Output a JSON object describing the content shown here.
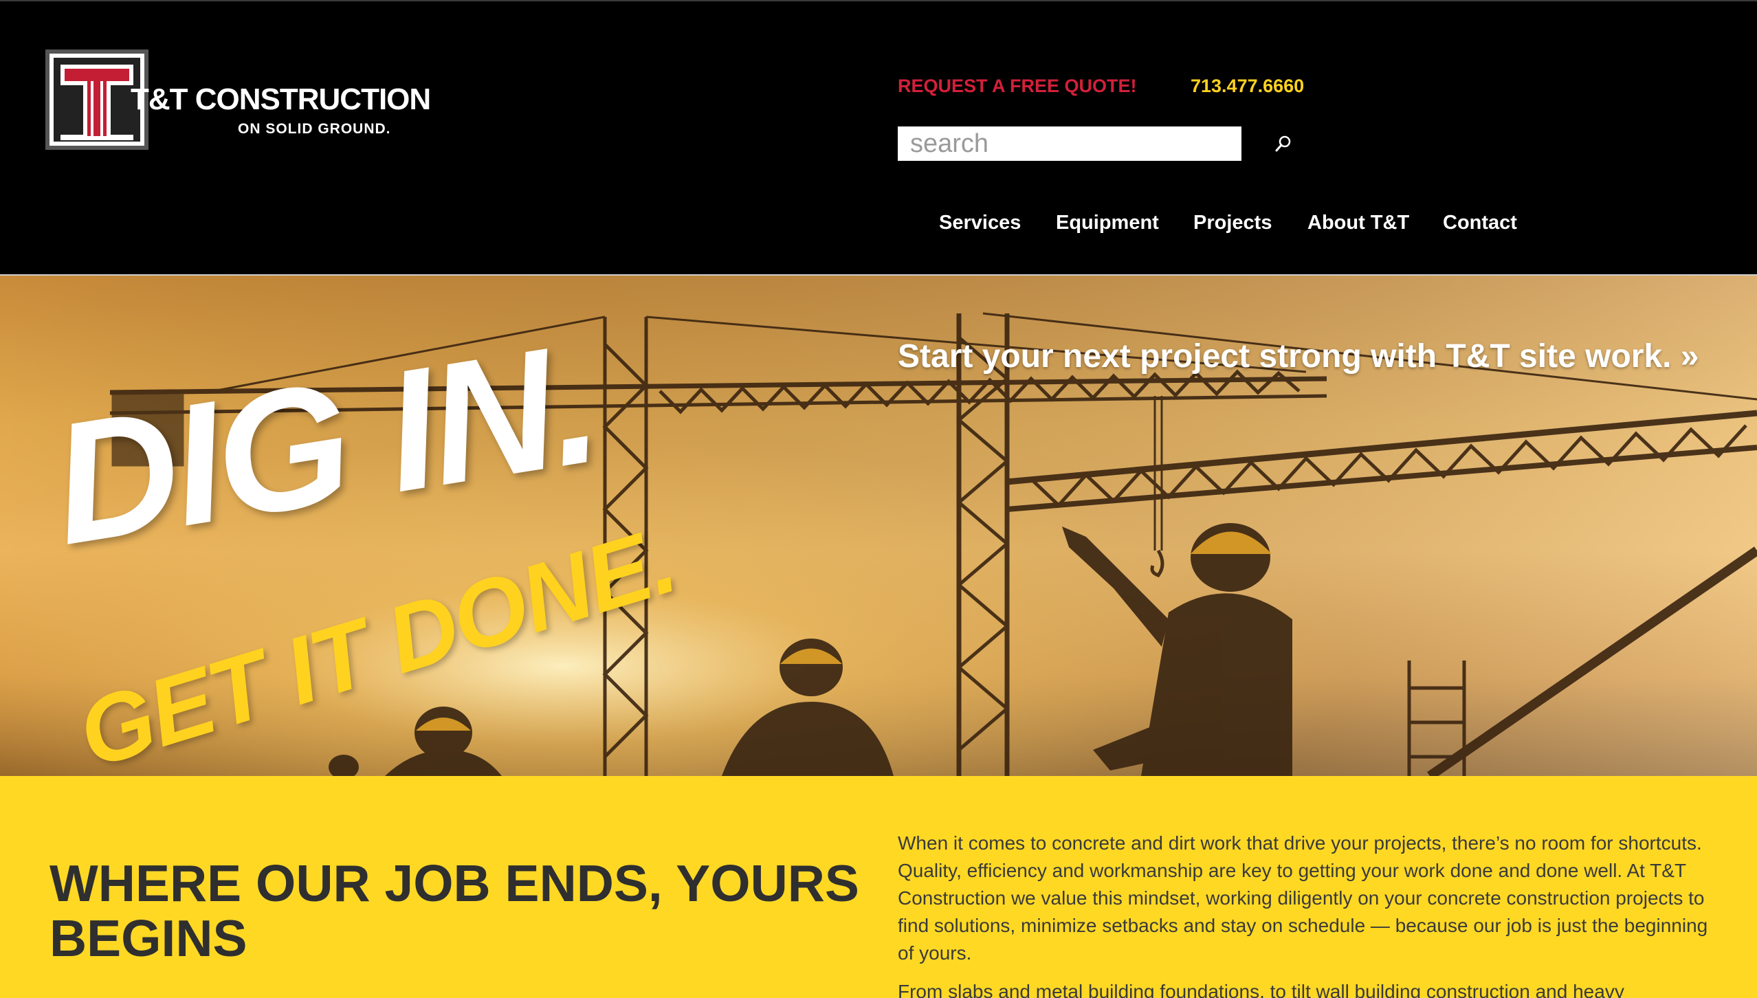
{
  "header": {
    "logo": {
      "monogram": "TT",
      "name": "T&T CONSTRUCTION",
      "tagline": "ON SOLID GROUND."
    },
    "quote_link": "REQUEST A FREE QUOTE!",
    "phone": "713.477.6660",
    "search": {
      "placeholder": "search",
      "value": "",
      "icon": "search-icon"
    },
    "nav": [
      {
        "label": "Services"
      },
      {
        "label": "Equipment"
      },
      {
        "label": "Projects"
      },
      {
        "label": "About T&T"
      },
      {
        "label": "Contact"
      }
    ]
  },
  "hero": {
    "cta": "Start your next project strong with T&T site work. »",
    "headline": "DIG IN.",
    "subheadline": "GET IT DONE."
  },
  "content": {
    "heading": "WHERE OUR JOB ENDS, YOURS BEGINS",
    "paragraphs": [
      "When it comes to concrete and dirt work that drive your projects, there’s no room for shortcuts. Quality, efficiency and workmanship are key to getting your work done and done well. At T&T Construction we value this mindset, working diligently on your concrete construction projects to find solutions, minimize setbacks and stay on schedule — because our job is just the beginning of yours.",
      "From slabs and metal building foundations, to tilt wall building construction and heavy"
    ]
  },
  "colors": {
    "header_bg": "#000000",
    "brand_red": "#d3203a",
    "brand_yellow": "#ffd21f",
    "content_bg": "#ffd824",
    "heading_text": "#2f2f2f"
  }
}
